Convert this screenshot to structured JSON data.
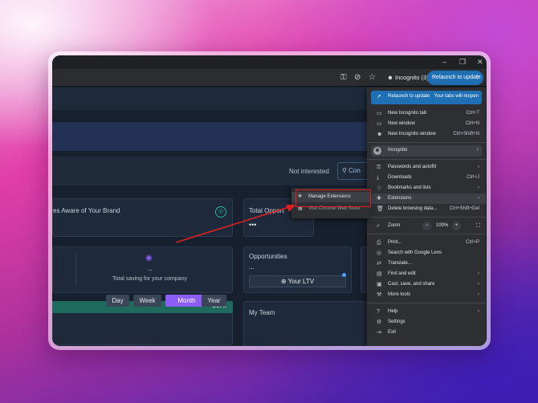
{
  "browser": {
    "incognito_label": "Incognito (3)",
    "relaunch_label": "Relaunch to update"
  },
  "page": {
    "not_interested": "Not interested",
    "con_button": "Con",
    "brand_card_title": "es Aware of Your Brand",
    "total_card_title": "Total Opport",
    "total_dots": "•••",
    "saving_dots": "...",
    "saving_label": "Total saving for your company",
    "opportunities_title": "Opportunities",
    "opportunities_dots": "...",
    "ltv_button": "Your LTV",
    "got_it": "Got It",
    "periods": [
      "Day",
      "Week",
      "Month",
      "Year"
    ],
    "team_title": "My Team",
    "accent_color": "#8b5cf6",
    "teal_color": "#1e6b5e"
  },
  "menu": {
    "relaunch_item": "Relaunch to update",
    "relaunch_note": "Your tabs will reopen",
    "new_incognito_tab": "New Incognito tab",
    "new_incognito_tab_sc": "Ctrl+T",
    "new_window": "New window",
    "new_window_sc": "Ctrl+N",
    "new_incognito_window": "New Incognito window",
    "new_incognito_window_sc": "Ctrl+Shift+N",
    "profile": "Incognito",
    "passwords": "Passwords and autofill",
    "downloads": "Downloads",
    "downloads_sc": "Ctrl+J",
    "bookmarks": "Bookmarks and lists",
    "extensions": "Extensions",
    "delete_browsing": "Delete browsing data...",
    "delete_browsing_sc": "Ctrl+Shift+Del",
    "zoom_label": "Zoom",
    "zoom_minus": "−",
    "zoom_value": "100%",
    "zoom_plus": "+",
    "print": "Print...",
    "print_sc": "Ctrl+P",
    "search_lens": "Search with Google Lens",
    "translate": "Translate...",
    "find_edit": "Find and edit",
    "cast_save": "Cast, save, and share",
    "more_tools": "More tools",
    "help": "Help",
    "settings": "Settings",
    "exit": "Exit"
  },
  "submenu": {
    "manage_extensions": "Manage Extensions",
    "visit_store": "Visit Chrome Web Store"
  }
}
